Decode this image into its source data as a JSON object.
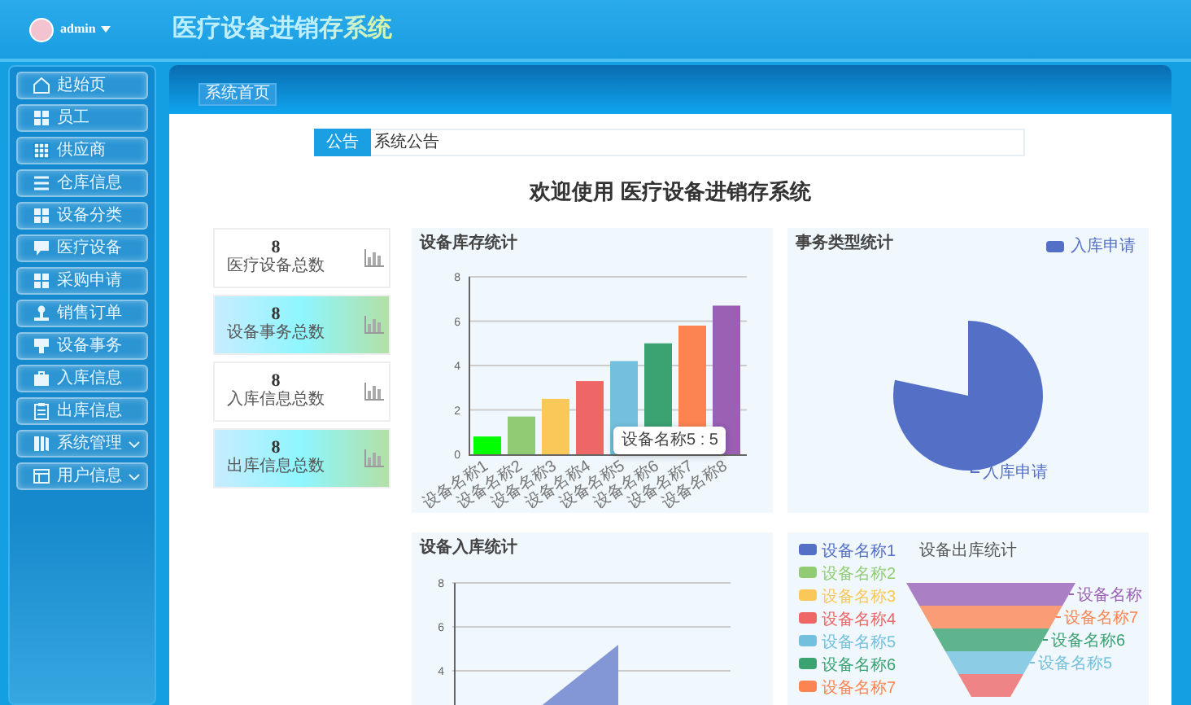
{
  "header": {
    "user": "admin",
    "title": "医疗设备进销存系统"
  },
  "sidebar": {
    "items": [
      {
        "label": "起始页",
        "kind": "link",
        "selected": false
      },
      {
        "label": "员工",
        "kind": "link",
        "selected": false
      },
      {
        "label": "供应商",
        "kind": "link",
        "selected": false
      },
      {
        "label": "仓库信息",
        "kind": "link",
        "selected": false
      },
      {
        "label": "设备分类",
        "kind": "link",
        "selected": false
      },
      {
        "label": "医疗设备",
        "kind": "link",
        "selected": false
      },
      {
        "label": "采购申请",
        "kind": "link",
        "selected": false
      },
      {
        "label": "销售订单",
        "kind": "link",
        "selected": false
      },
      {
        "label": "设备事务",
        "kind": "link",
        "selected": false
      },
      {
        "label": "入库信息",
        "kind": "link",
        "selected": false
      },
      {
        "label": "出库信息",
        "kind": "link",
        "selected": false
      },
      {
        "label": "系统管理",
        "kind": "group",
        "selected": false,
        "expanded": false
      },
      {
        "label": "用户信息",
        "kind": "group",
        "selected": false,
        "expanded": false
      }
    ]
  },
  "breadcrumb": [
    "系统首页"
  ],
  "notice": {
    "tag": "公告",
    "text": "系统公告"
  },
  "welcome": "欢迎使用 医疗设备进销存系统",
  "stats": [
    {
      "value": "8",
      "label": "医疗设备总数",
      "tinted": false
    },
    {
      "value": "8",
      "label": "设备事务总数",
      "tinted": true
    },
    {
      "value": "8",
      "label": "入库信息总数",
      "tinted": false
    },
    {
      "value": "8",
      "label": "出库信息总数",
      "tinted": true
    }
  ],
  "inventory_chart": {
    "title": "设备库存统计",
    "tooltip": "设备名称5 : 5",
    "chart_data": {
      "type": "bar",
      "categories": [
        "设备名称1",
        "设备名称2",
        "设备名称3",
        "设备名称4",
        "设备名称5",
        "设备名称6",
        "设备名称7",
        "设备名称8"
      ],
      "values": [
        0.8,
        1.7,
        2.5,
        3.3,
        4.2,
        5,
        5.8,
        6.7
      ],
      "ylim": [
        0,
        8
      ],
      "yticks": [
        0,
        2,
        4,
        6,
        8
      ],
      "grid": true
    }
  },
  "transaction_chart": {
    "title": "事务类型统计",
    "legend": [
      "入库申请"
    ],
    "slice_label": "入库申请"
  },
  "inbound_chart": {
    "title": "设备入库统计",
    "y_tick_labels": [
      "8",
      "6",
      "4"
    ]
  },
  "outbound_chart": {
    "title": "设备出库统计",
    "legend": [
      {
        "label": "设备名称1",
        "color": "#5470c6"
      },
      {
        "label": "设备名称2",
        "color": "#91cc75"
      },
      {
        "label": "设备名称3",
        "color": "#fac858"
      },
      {
        "label": "设备名称4",
        "color": "#ee6666"
      },
      {
        "label": "设备名称5",
        "color": "#73c0de"
      },
      {
        "label": "设备名称6",
        "color": "#3ba272"
      },
      {
        "label": "设备名称7",
        "color": "#fc8452"
      }
    ],
    "funnel_labels": [
      "设备名称",
      "设备名称7",
      "设备名称6",
      "设备名称5"
    ]
  }
}
